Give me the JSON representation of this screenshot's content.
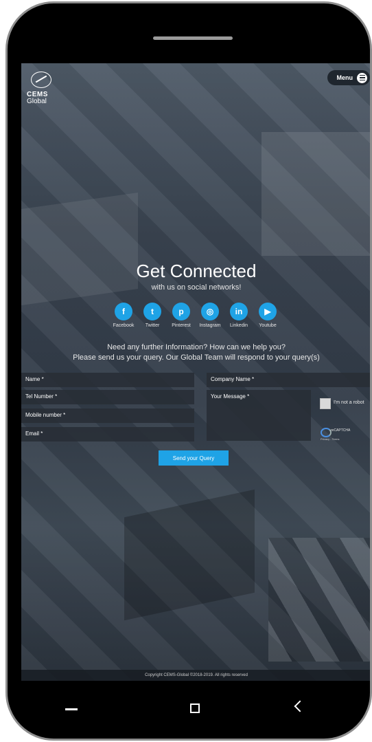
{
  "header": {
    "logo_text": "CEMS",
    "logo_sub": "Global",
    "menu_label": "Menu"
  },
  "hero": {
    "title": "Get Connected",
    "subtitle": "with us on social networks!"
  },
  "socials": [
    {
      "label": "Facebook",
      "glyph": "f",
      "icon": "facebook-icon"
    },
    {
      "label": "Twitter",
      "glyph": "t",
      "icon": "twitter-icon"
    },
    {
      "label": "Pinterest",
      "glyph": "p",
      "icon": "pinterest-icon"
    },
    {
      "label": "Instagram",
      "glyph": "◎",
      "icon": "instagram-icon"
    },
    {
      "label": "Linkedin",
      "glyph": "in",
      "icon": "linkedin-icon"
    },
    {
      "label": "Youtube",
      "glyph": "▶",
      "icon": "youtube-icon"
    }
  ],
  "info": {
    "line1": "Need any further Information? How can we help you?",
    "line2": "Please send us your query. Our Global Team will respond to your query(s)"
  },
  "form": {
    "name_placeholder": "Name *",
    "company_placeholder": "Company Name *",
    "tel_placeholder": "Tel Number *",
    "message_placeholder": "Your Message *",
    "mobile_placeholder": "Mobile number *",
    "email_placeholder": "Email *",
    "captcha_label": "I'm not a robot",
    "recaptcha_label": "reCAPTCHA",
    "recaptcha_sub": "Privacy - Terms",
    "send_label": "Send your Query"
  },
  "footer": {
    "copyright": "Copyright CEMS-Global ©2018-2019. All rights reserved"
  },
  "colors": {
    "accent": "#1fa3e6"
  }
}
